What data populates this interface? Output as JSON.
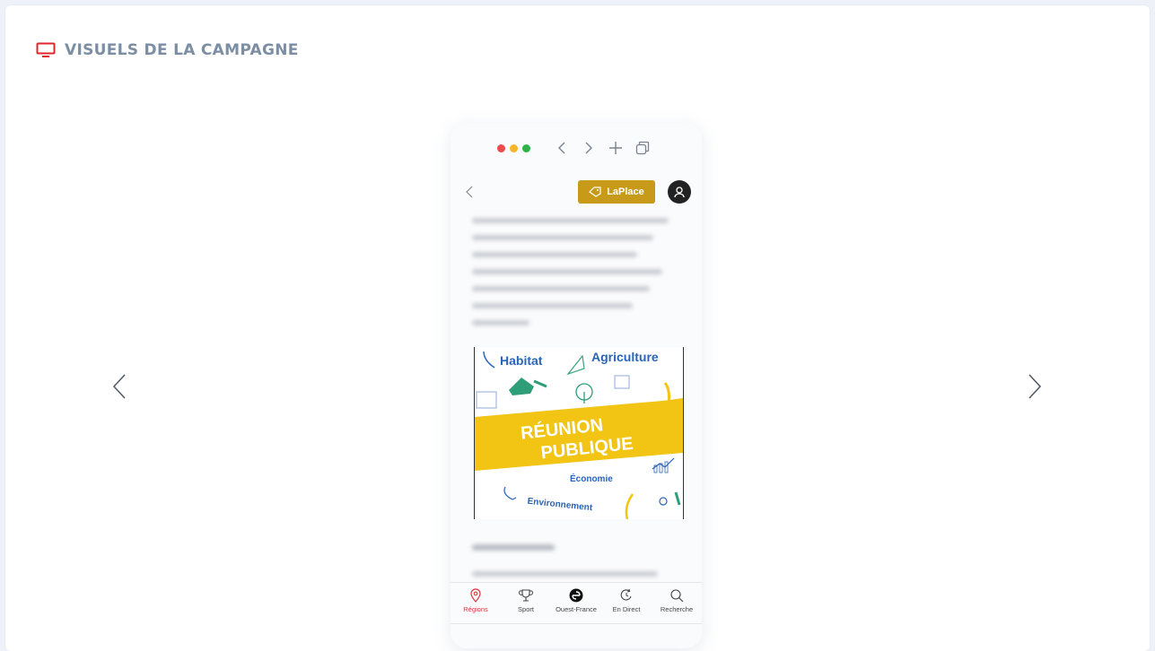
{
  "section": {
    "title": "VISUELS DE LA CAMPAGNE",
    "icon": "monitor-icon",
    "icon_color": "#e3262b"
  },
  "carousel": {
    "prev_icon": "chevron-left-icon",
    "next_icon": "chevron-right-icon"
  },
  "phone": {
    "browser": {
      "dots": [
        "#f0494e",
        "#f4b62b",
        "#2bb34a"
      ],
      "buttons": [
        "chevron-left-icon",
        "chevron-right-icon",
        "plus-icon",
        "tabs-icon"
      ]
    },
    "header": {
      "back_icon": "chevron-left-icon",
      "badge_label": "LaPlace",
      "badge_icon": "tag-icon",
      "badge_color": "#c79a1a",
      "profile_icon": "user-icon"
    },
    "poster": {
      "words": {
        "habitat": "Habitat",
        "agriculture": "Agriculture",
        "reunion": "RÉUNION",
        "publique": "PUBLIQUE",
        "economie": "Économie",
        "environnement": "Environnement"
      },
      "accent_color": "#f2c414",
      "text_color": "#2a64b8"
    },
    "tabbar": {
      "items": [
        {
          "label": "Régions",
          "icon": "map-pin-icon",
          "active": true
        },
        {
          "label": "Sport",
          "icon": "trophy-icon",
          "active": false
        },
        {
          "label": "Ouest-France",
          "icon": "ouest-france-logo-icon",
          "active": false
        },
        {
          "label": "En Direct",
          "icon": "live-refresh-icon",
          "active": false
        },
        {
          "label": "Recherche",
          "icon": "search-icon",
          "active": false
        }
      ],
      "active_color": "#d9363e"
    }
  }
}
